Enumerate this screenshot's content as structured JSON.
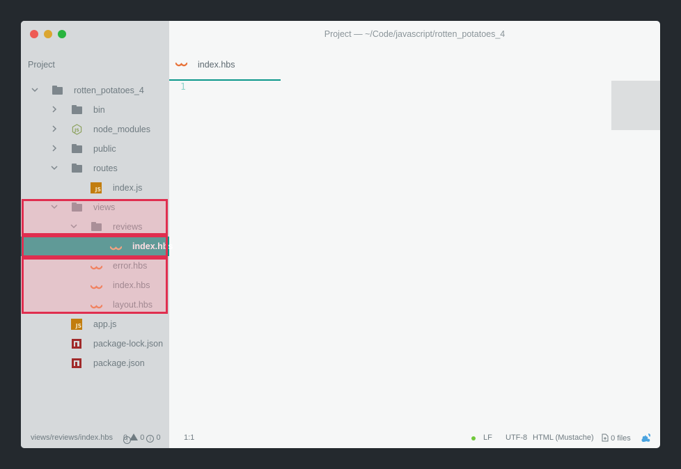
{
  "window": {
    "title": "Project — ~/Code/javascript/rotten_potatoes_4"
  },
  "sidebar": {
    "header": "Project",
    "tree": [
      {
        "label": "rotten_potatoes_4",
        "icon": "folder-icon",
        "chevron": "down"
      },
      {
        "label": "bin",
        "icon": "folder-icon",
        "chevron": "right"
      },
      {
        "label": "node_modules",
        "icon": "nodejs-icon",
        "chevron": "right"
      },
      {
        "label": "public",
        "icon": "folder-icon",
        "chevron": "right"
      },
      {
        "label": "routes",
        "icon": "folder-icon",
        "chevron": "down"
      },
      {
        "label": "index.js",
        "icon": "javascript-file-icon"
      },
      {
        "label": "views",
        "icon": "folder-icon",
        "chevron": "down"
      },
      {
        "label": "reviews",
        "icon": "folder-icon",
        "chevron": "down"
      },
      {
        "label": "index.hbs",
        "icon": "mustache-file-icon",
        "selected": true
      },
      {
        "label": "error.hbs",
        "icon": "mustache-file-icon"
      },
      {
        "label": "index.hbs",
        "icon": "mustache-file-icon"
      },
      {
        "label": "layout.hbs",
        "icon": "mustache-file-icon"
      },
      {
        "label": "app.js",
        "icon": "javascript-file-icon"
      },
      {
        "label": "package-lock.json",
        "icon": "npm-file-icon"
      },
      {
        "label": "package.json",
        "icon": "npm-file-icon"
      }
    ]
  },
  "editor": {
    "tab_label": "index.hbs",
    "tab_icon": "mustache-file-icon",
    "line_number": "1"
  },
  "statusbar": {
    "path": "views/reviews/index.hbs",
    "errors": "0",
    "warnings": "0",
    "infos": "0",
    "cursor": "1:1",
    "line_ending": "LF",
    "encoding": "UTF-8",
    "grammar": "HTML (Mustache)",
    "git_files": "0 files"
  },
  "colors": {
    "accent": "#0b978a",
    "highlight_border": "#e02e4f",
    "mustache": "#e8733a",
    "js": "#c27d0e",
    "npm": "#a02a2a"
  }
}
